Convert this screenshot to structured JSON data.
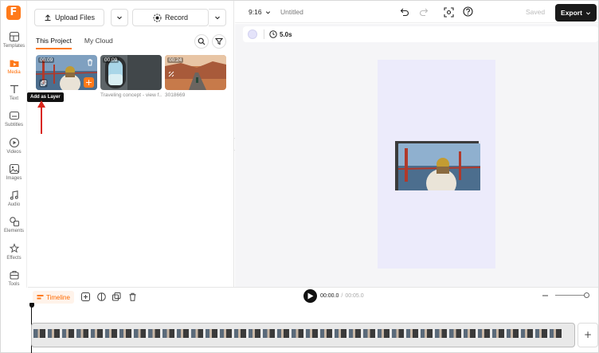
{
  "sidebar": {
    "logo": "F",
    "items": [
      {
        "label": "Templates",
        "icon": "templates-icon"
      },
      {
        "label": "Media",
        "icon": "media-icon",
        "active": true
      },
      {
        "label": "Text",
        "icon": "text-icon"
      },
      {
        "label": "Subtitles",
        "icon": "subtitles-icon"
      },
      {
        "label": "Videos",
        "icon": "videos-icon"
      },
      {
        "label": "Images",
        "icon": "images-icon"
      },
      {
        "label": "Audio",
        "icon": "audio-icon"
      },
      {
        "label": "Elements",
        "icon": "elements-icon"
      },
      {
        "label": "Effects",
        "icon": "effects-icon"
      },
      {
        "label": "Tools",
        "icon": "tools-icon"
      }
    ]
  },
  "media_panel": {
    "upload_label": "Upload Files",
    "record_label": "Record",
    "tabs": [
      {
        "label": "This Project",
        "active": true
      },
      {
        "label": "My Cloud"
      }
    ],
    "items": [
      {
        "duration": "00:09",
        "caption": ""
      },
      {
        "duration": "00:09",
        "caption": "Traveling concept - view f..."
      },
      {
        "duration": "00:24",
        "caption": "3018669"
      }
    ],
    "tooltip": "Add as Layer"
  },
  "topbar": {
    "aspect": "9:16",
    "project_title": "Untitled",
    "saved_label": "Saved",
    "export_label": "Export"
  },
  "canvas": {
    "duration_label": "5.0s",
    "page_color": "#ecebfb"
  },
  "timeline": {
    "label": "Timeline",
    "current_time": "00:00.0",
    "separator": "/",
    "total_time": "00:05.0"
  },
  "colors": {
    "accent": "#ff7a1a",
    "dark": "#1a1a1a"
  }
}
